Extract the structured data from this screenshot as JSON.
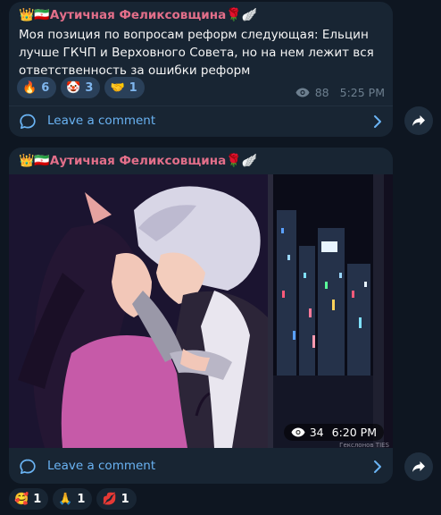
{
  "post1": {
    "author": {
      "prefix_emoji": "👑🇮🇷",
      "name": "Аутичная Феликсовщина",
      "suffix_emoji": "🌹🪽"
    },
    "text": "Моя позиция по вопросам реформ следующая: Ельцин лучше ГКЧП и Верховного Совета, но на нем лежит вся ответственность за ошибки реформ",
    "reactions": [
      {
        "emoji": "🔥",
        "count": "6"
      },
      {
        "emoji": "🤡",
        "count": "3"
      },
      {
        "emoji": "🤝",
        "count": "1"
      }
    ],
    "views": "88",
    "time": "5:25 PM",
    "comment_label": "Leave a comment"
  },
  "post2": {
    "author": {
      "prefix_emoji": "👑🇮🇷",
      "name": "Аутичная Феликсовщина",
      "suffix_emoji": "🌹🪽"
    },
    "image": {
      "watermark": "Гекслонов ТIES"
    },
    "views": "34",
    "time": "6:20 PM",
    "comment_label": "Leave a comment",
    "reactions": [
      {
        "emoji": "🥰",
        "count": "1"
      },
      {
        "emoji": "🙏",
        "count": "1"
      },
      {
        "emoji": "💋",
        "count": "1"
      }
    ]
  },
  "icons": {
    "views": "eye-icon",
    "comment": "comment-bubble-icon",
    "chevron": "chevron-right-icon",
    "share": "share-arrow-icon"
  },
  "colors": {
    "background": "#0e1621",
    "bubble": "#182533",
    "author": "#e36f8a",
    "link": "#6ab3f3",
    "reaction_bg": "#2a4059",
    "reaction_text": "#7fb6ee",
    "meta": "#6d7f8f"
  }
}
